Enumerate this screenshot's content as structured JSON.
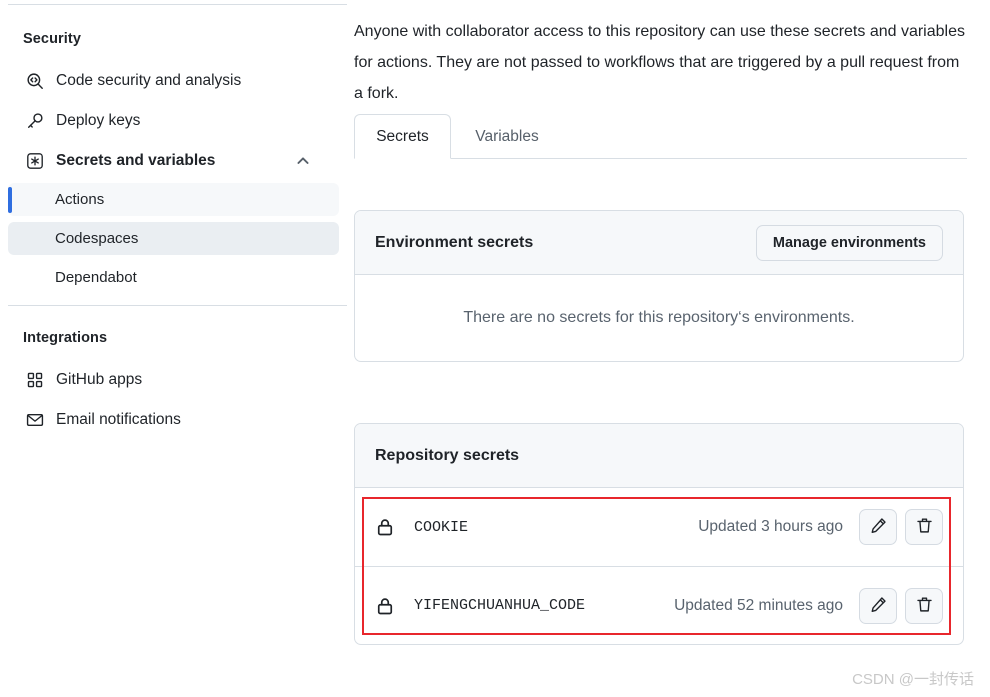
{
  "sidebar": {
    "groups": [
      {
        "title": "Security",
        "items": [
          {
            "label": "Code security and analysis",
            "icon": "code-scanning-icon"
          },
          {
            "label": "Deploy keys",
            "icon": "key-icon"
          },
          {
            "label": "Secrets and variables",
            "icon": "asterisk-square-icon",
            "expanded": true,
            "chevron": "chevron-up-icon"
          }
        ],
        "subitems": [
          {
            "label": "Actions",
            "state": "selected"
          },
          {
            "label": "Codespaces",
            "state": "hovered"
          },
          {
            "label": "Dependabot",
            "state": "default"
          }
        ]
      },
      {
        "title": "Integrations",
        "items": [
          {
            "label": "GitHub apps",
            "icon": "apps-grid-icon"
          },
          {
            "label": "Email notifications",
            "icon": "mail-icon"
          }
        ]
      }
    ]
  },
  "main": {
    "intro": "Anyone with collaborator access to this repository can use these secrets and variables for actions. They are not passed to workflows that are triggered by a pull request from a fork.",
    "tabs": [
      {
        "label": "Secrets",
        "active": true
      },
      {
        "label": "Variables",
        "active": false
      }
    ],
    "environment_secrets": {
      "title": "Environment secrets",
      "manage_button": "Manage environments",
      "empty_message": "There are no secrets for this repository‘s environments."
    },
    "repository_secrets": {
      "title": "Repository secrets",
      "rows": [
        {
          "name": "COOKIE",
          "updated": "Updated 3 hours ago",
          "lock_icon": "lock-icon",
          "edit_icon": "pencil-icon",
          "delete_icon": "trash-icon"
        },
        {
          "name": "YIFENGCHUANHUA_CODE",
          "updated": "Updated 52 minutes ago",
          "lock_icon": "lock-icon",
          "edit_icon": "pencil-icon",
          "delete_icon": "trash-icon"
        }
      ]
    }
  },
  "watermark": "CSDN @一封传话",
  "colors": {
    "accent_blue": "#2f6ee0",
    "annotation_red": "#e8262c",
    "border": "#d8dee4",
    "muted_text": "#59636e",
    "panel_bg": "#f6f8fa"
  }
}
